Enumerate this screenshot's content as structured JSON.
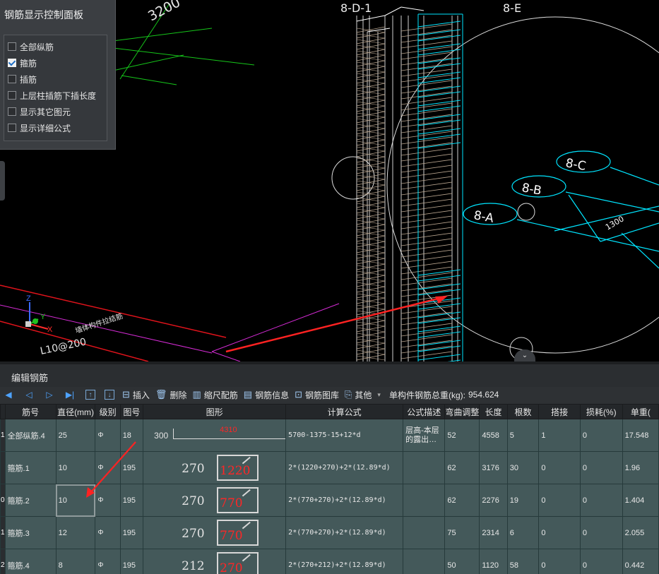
{
  "viewport": {
    "labels": {
      "dim_top": "3200",
      "axis_left": "8-D-1",
      "axis_right": "8-E",
      "bubble_c": "8-C",
      "bubble_b": "8-B",
      "bubble_a": "8-A",
      "dim_right": "1300",
      "beam_label": "L10@200",
      "beam_note": "墙体构件拉结筋"
    },
    "axis_x": "X",
    "axis_y": "Y",
    "axis_z": "Z",
    "colors": {
      "cyan": "#00e5ff",
      "green": "#16c61a",
      "red": "#e0131b",
      "magenta": "#d52bd5",
      "rebar": "#b9a58f",
      "arrow": "#ff2222"
    }
  },
  "control_panel": {
    "title": "钢筋显示控制面板",
    "options": [
      {
        "label": "全部纵筋",
        "checked": false
      },
      {
        "label": "箍筋",
        "checked": true
      },
      {
        "label": "插筋",
        "checked": false
      },
      {
        "label": "上层柱插筋下插长度",
        "checked": false
      },
      {
        "label": "显示其它图元",
        "checked": false
      },
      {
        "label": "显示详细公式",
        "checked": false
      }
    ]
  },
  "editor": {
    "title": "编辑钢筋",
    "toolbar": {
      "insert": "插入",
      "delete": "删除",
      "scale": "缩尺配筋",
      "info": "钢筋信息",
      "library": "钢筋图库",
      "other": "其他",
      "total_label": "单构件钢筋总重(kg):",
      "total_value": "954.624"
    },
    "columns": [
      "筋号",
      "直径(mm)",
      "级别",
      "图号",
      "图形",
      "计算公式",
      "公式描述",
      "弯曲调整",
      "长度",
      "根数",
      "搭接",
      "损耗(%)",
      "单重("
    ],
    "rows": [
      {
        "rn": "1",
        "name": "全部纵筋.4",
        "dia": "25",
        "grade": "Φ",
        "fig": "18",
        "s1": "300",
        "s2": "4310",
        "formula": "5700-1375-15+12*d",
        "desc": "层高-本层的露出…",
        "bend": "52",
        "len": "4558",
        "qty": "5",
        "lap": "1",
        "loss": "0",
        "unit": "17.548"
      },
      {
        "rn": "",
        "name": "箍筋.1",
        "dia": "10",
        "grade": "Φ",
        "fig": "195",
        "s1": "270",
        "s2": "1220",
        "formula": "2*(1220+270)+2*(12.89*d)",
        "desc": "",
        "bend": "62",
        "len": "3176",
        "qty": "30",
        "lap": "0",
        "loss": "0",
        "unit": "1.96"
      },
      {
        "rn": "0",
        "name": "箍筋.2",
        "dia": "10",
        "grade": "Φ",
        "fig": "195",
        "s1": "270",
        "s2": "770",
        "formula": "2*(770+270)+2*(12.89*d)",
        "desc": "",
        "bend": "62",
        "len": "2276",
        "qty": "19",
        "lap": "0",
        "loss": "0",
        "unit": "1.404"
      },
      {
        "rn": "1",
        "name": "箍筋.3",
        "dia": "12",
        "grade": "Φ",
        "fig": "195",
        "s1": "270",
        "s2": "770",
        "formula": "2*(770+270)+2*(12.89*d)",
        "desc": "",
        "bend": "75",
        "len": "2314",
        "qty": "6",
        "lap": "0",
        "loss": "0",
        "unit": "2.055"
      },
      {
        "rn": "2",
        "name": "箍筋.4",
        "dia": "8",
        "grade": "Φ",
        "fig": "195",
        "s1": "212",
        "s2": "270",
        "formula": "2*(270+212)+2*(12.89*d)",
        "desc": "",
        "bend": "50",
        "len": "1120",
        "qty": "58",
        "lap": "0",
        "loss": "0",
        "unit": "0.442"
      }
    ]
  }
}
